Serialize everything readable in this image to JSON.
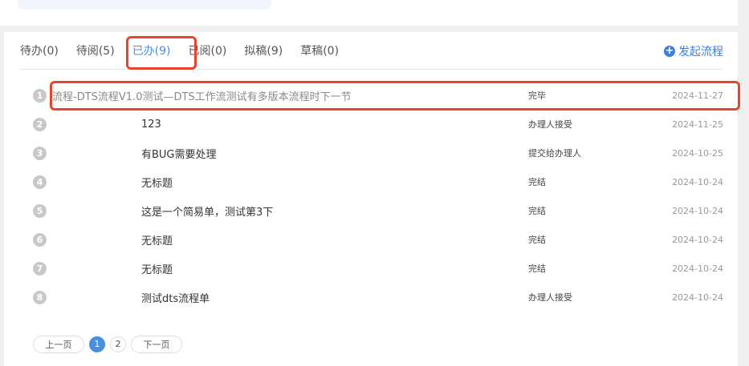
{
  "tabs": [
    {
      "label": "待办(0)"
    },
    {
      "label": "待阅(5)"
    },
    {
      "label": "已办(9)"
    },
    {
      "label": "已阅(0)"
    },
    {
      "label": "拟稿(9)"
    },
    {
      "label": "草稿(0)"
    }
  ],
  "active_tab": "已办(9)",
  "new_process_label": "发起流程",
  "rows": [
    {
      "num": "1",
      "title": "流程-DTS流程V1.0测试—DTS工作流测试有多版本流程时下一节",
      "status": "完毕",
      "date": "2024-11-27"
    },
    {
      "num": "2",
      "title": "123",
      "status": "办理人接受",
      "date": "2024-11-25"
    },
    {
      "num": "3",
      "title": "有BUG需要处理",
      "status": "提交给办理人",
      "date": "2024-10-25"
    },
    {
      "num": "4",
      "title": "无标题",
      "status": "完结",
      "date": "2024-10-24"
    },
    {
      "num": "5",
      "title": "这是一个简易单，测试第3下",
      "status": "完结",
      "date": "2024-10-24"
    },
    {
      "num": "6",
      "title": "无标题",
      "status": "完结",
      "date": "2024-10-24"
    },
    {
      "num": "7",
      "title": "无标题",
      "status": "完结",
      "date": "2024-10-24"
    },
    {
      "num": "8",
      "title": "测试dts流程单",
      "status": "办理人接受",
      "date": "2024-10-24"
    }
  ],
  "pagination": {
    "prev": "上一页",
    "pages": [
      "1",
      "2"
    ],
    "current": "1",
    "next": "下一页"
  }
}
